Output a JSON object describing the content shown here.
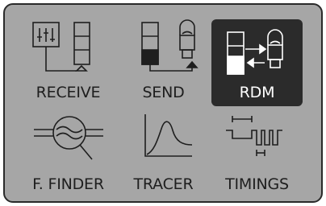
{
  "menu": {
    "tiles": [
      {
        "label": "RECEIVE",
        "icon": "receive-icon",
        "selected": false
      },
      {
        "label": "SEND",
        "icon": "send-icon",
        "selected": false
      },
      {
        "label": "RDM",
        "icon": "rdm-icon",
        "selected": true
      },
      {
        "label": "F. FINDER",
        "icon": "fault-finder-icon",
        "selected": false
      },
      {
        "label": "TRACER",
        "icon": "tracer-icon",
        "selected": false
      },
      {
        "label": "TIMINGS",
        "icon": "timings-icon",
        "selected": false
      }
    ]
  },
  "colors": {
    "screen_background": "#a6a6a6",
    "selected_tile": "#2b2b2b",
    "icon_stroke": "#1e1e1e",
    "selected_text": "#ffffff"
  }
}
